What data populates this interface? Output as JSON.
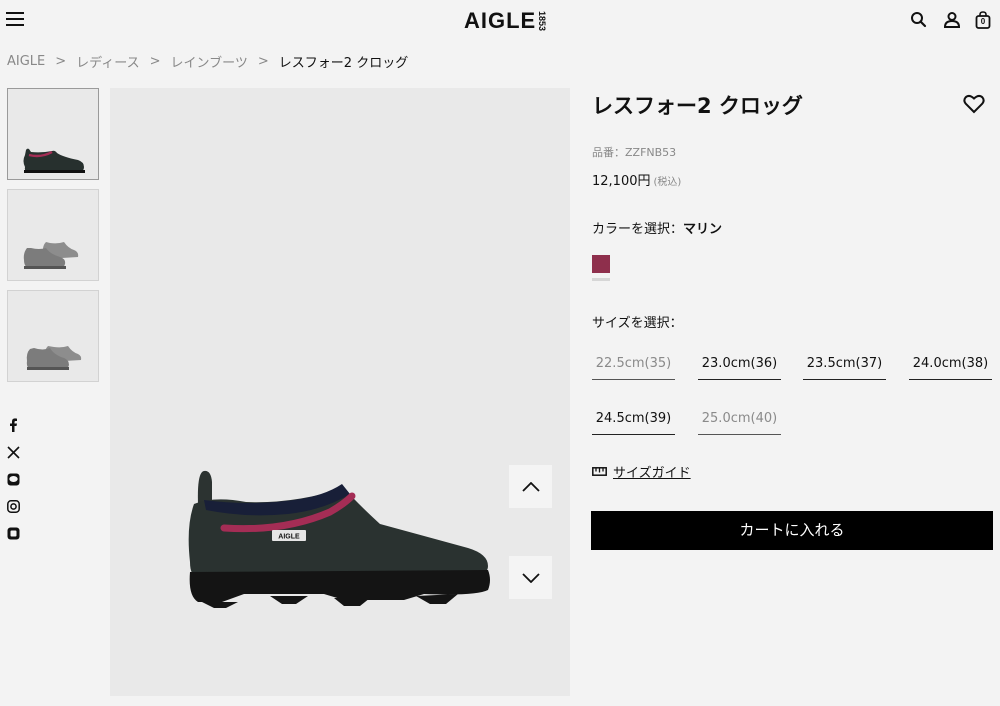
{
  "header": {
    "logo_text": "AIGLE",
    "logo_year": "1853",
    "icons": [
      "menu-icon",
      "search-icon",
      "account-icon",
      "cart-bag-icon"
    ],
    "cart_count": "0"
  },
  "breadcrumb": {
    "items": [
      "AIGLE",
      "レディース",
      "レインブーツ",
      "レスフォー2 クロッグ"
    ],
    "separator": ">"
  },
  "thumbnails": [
    {
      "name": "thumb-1",
      "active": true
    },
    {
      "name": "thumb-2",
      "active": false
    },
    {
      "name": "thumb-3",
      "active": false
    }
  ],
  "social": [
    "facebook-icon",
    "x-icon",
    "line-icon",
    "instagram-icon",
    "note-icon"
  ],
  "gallery": {
    "up_icon": "chevron-up-icon",
    "down_icon": "chevron-down-icon",
    "shoe_brand_tag": "AIGLE"
  },
  "product": {
    "title": "レスフォー2 クロッグ",
    "sku": "品番：ZZFNB53",
    "price": "12,100円",
    "tax_note": "(税込)",
    "color_label": "カラーを選択：",
    "color_value": "マリン",
    "swatch_color": "#8e2f4c",
    "size_label": "サイズを選択：",
    "sizes": [
      {
        "label": "22.5cm(35)",
        "available": false
      },
      {
        "label": "23.0cm(36)",
        "available": true
      },
      {
        "label": "23.5cm(37)",
        "available": true
      },
      {
        "label": "24.0cm(38)",
        "available": true
      },
      {
        "label": "24.5cm(39)",
        "available": true
      },
      {
        "label": "25.0cm(40)",
        "available": false
      }
    ],
    "size_guide": "サイズガイド",
    "add_to_cart": "カートに入れる"
  },
  "colors": {
    "accent": "#8e2f4c",
    "button_bg": "#000000",
    "page_bg": "#f3f3f3"
  }
}
